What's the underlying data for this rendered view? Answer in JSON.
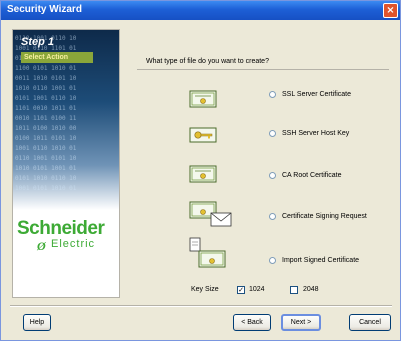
{
  "window": {
    "title": "Security Wizard",
    "close_glyph": "×"
  },
  "sidebar": {
    "step": "Step 1",
    "substep": "Select Action",
    "brand_name": "Schneider",
    "brand_sub": "Electric"
  },
  "content": {
    "question": "What type of file do you want to create?",
    "options": [
      {
        "label": "SSL Server Certificate",
        "icon": "certificate-icon"
      },
      {
        "label": "SSH Server Host Key",
        "icon": "key-certificate-icon"
      },
      {
        "label": "CA Root Certificate",
        "icon": "certificate-icon"
      },
      {
        "label": "Certificate Signing Request",
        "icon": "certificate-envelope-icon"
      },
      {
        "label": "Import Signed Certificate",
        "icon": "import-certificate-icon"
      }
    ],
    "key_size": {
      "label": "Key Size",
      "options": [
        {
          "label": "1024",
          "checked": true
        },
        {
          "label": "2048",
          "checked": false
        }
      ]
    }
  },
  "buttons": {
    "help": "Help",
    "back": "< Back",
    "next": "Next >",
    "cancel": "Cancel"
  },
  "colors": {
    "titlebar": "#1d5fd6",
    "brand_green": "#3daa35",
    "dialog_bg": "#ece9d8"
  }
}
